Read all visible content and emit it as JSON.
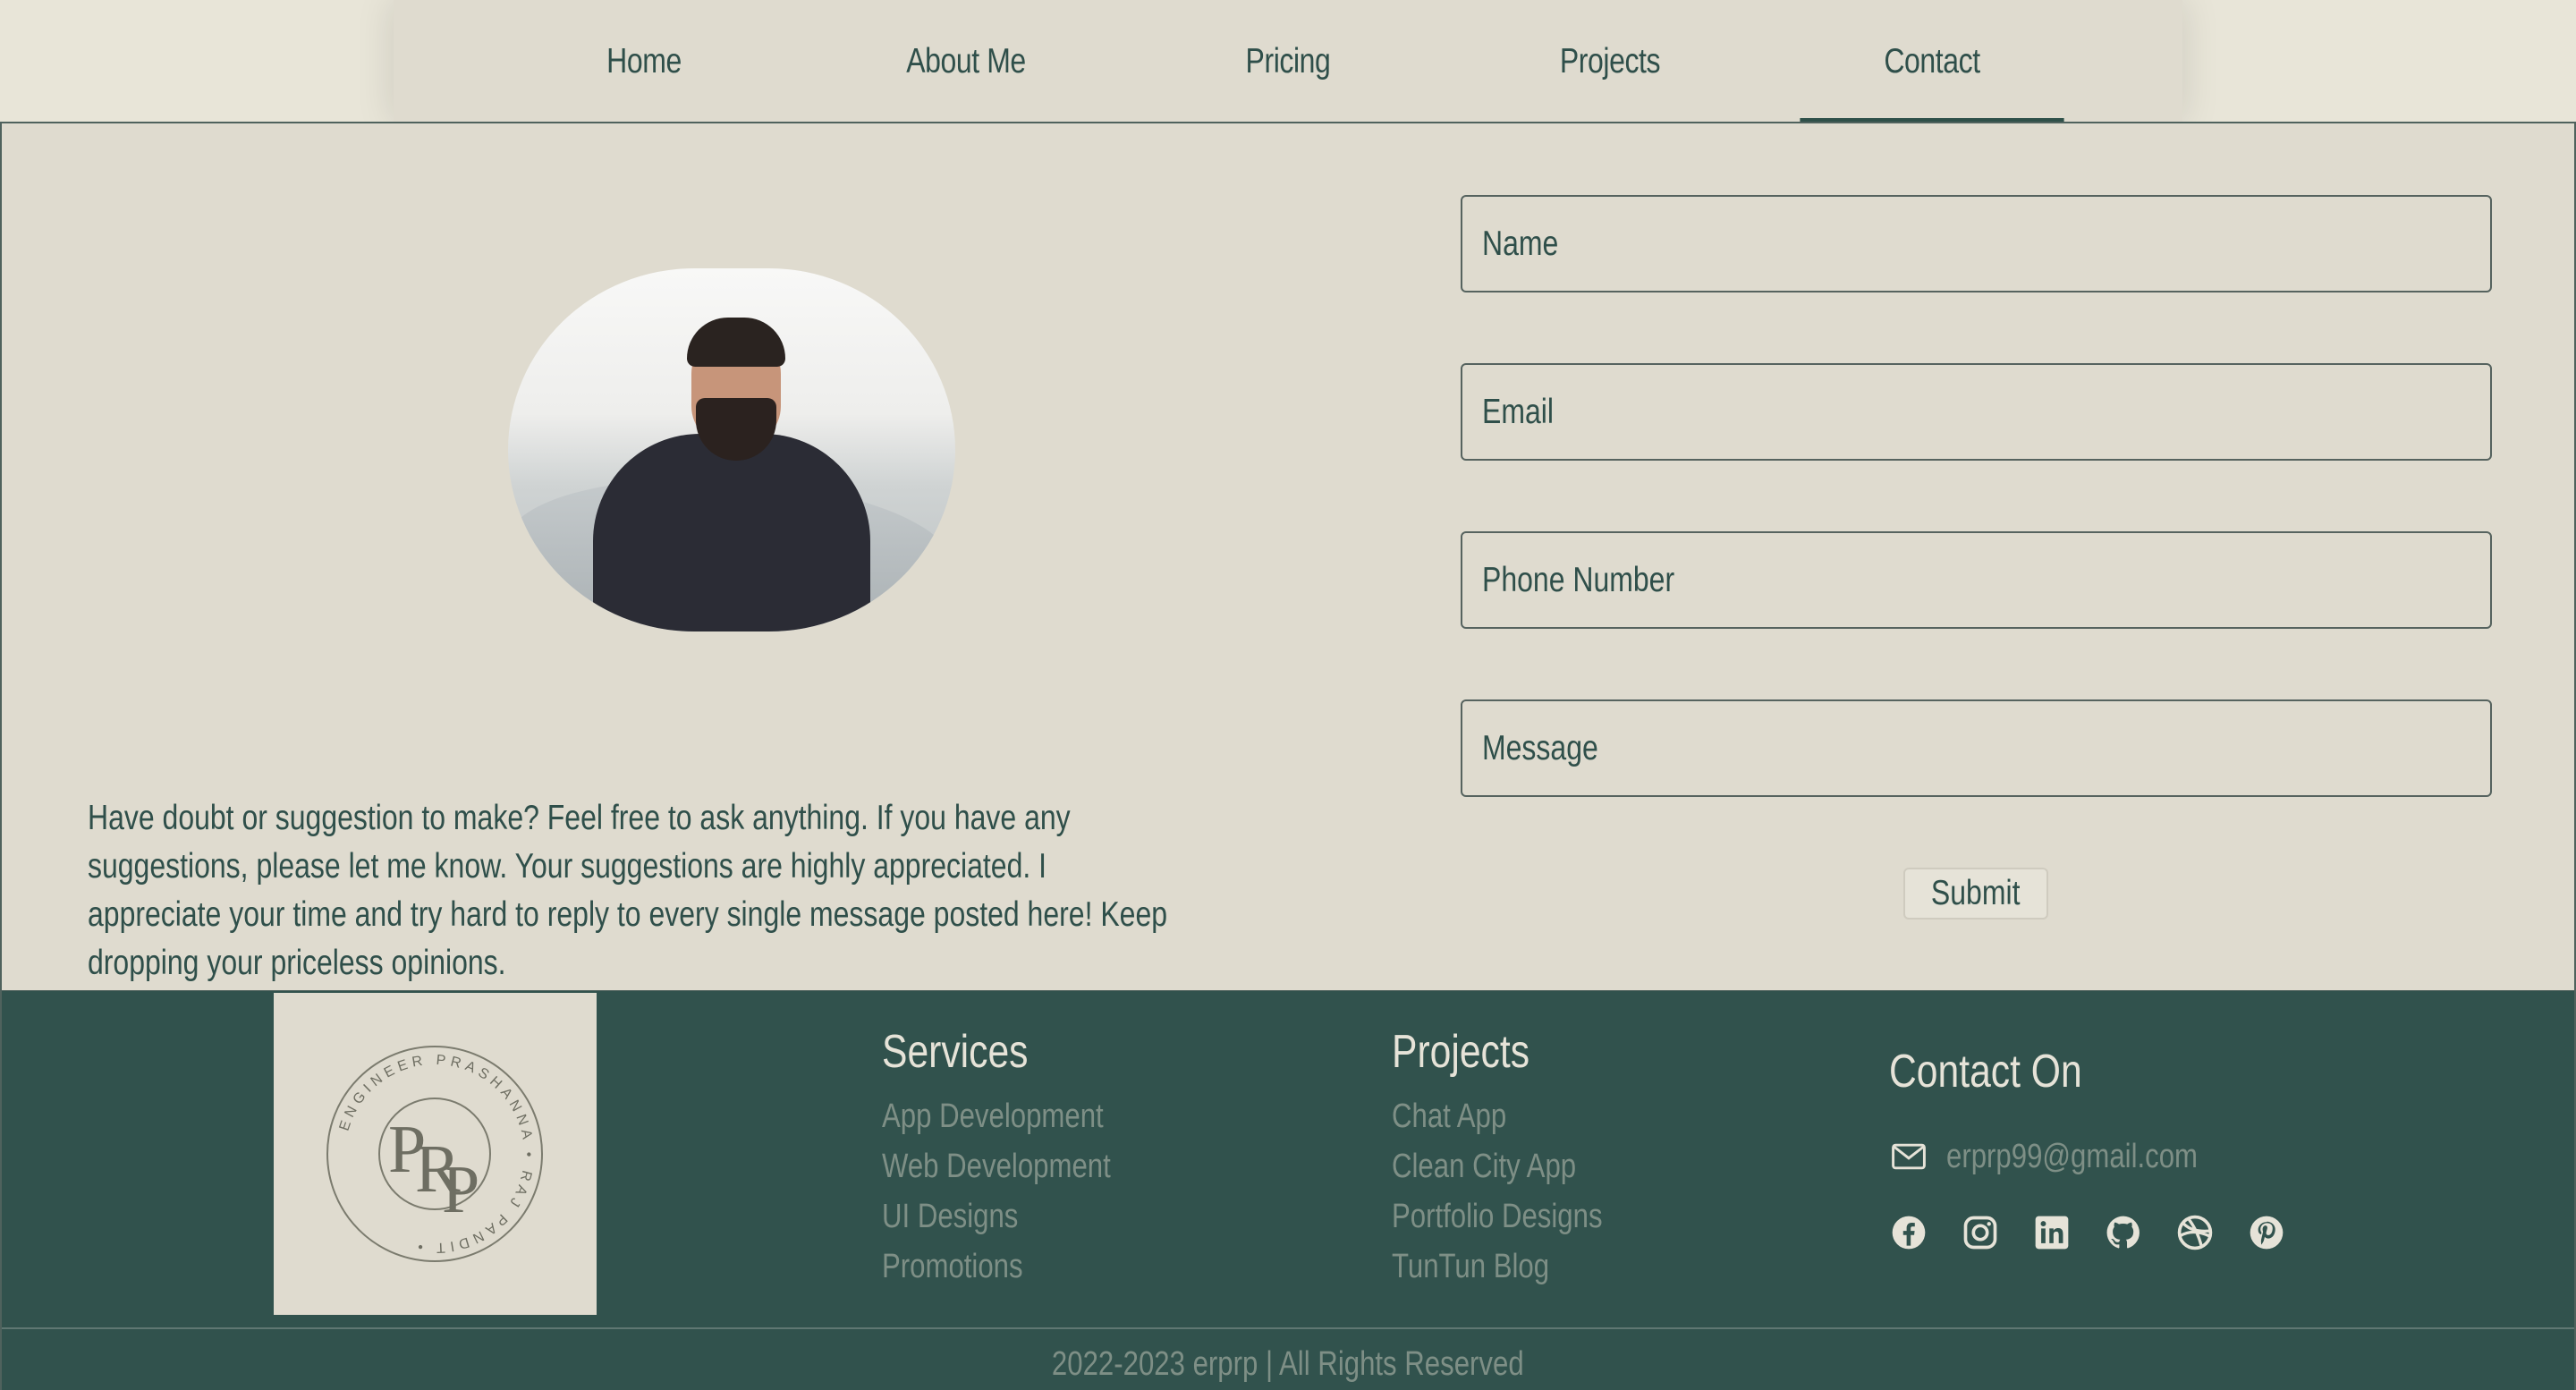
{
  "nav": {
    "items": [
      {
        "label": "Home"
      },
      {
        "label": "About Me"
      },
      {
        "label": "Pricing"
      },
      {
        "label": "Projects"
      },
      {
        "label": "Contact"
      }
    ],
    "active": "Contact"
  },
  "contact": {
    "intro": "Have doubt or suggestion to make? Feel free to ask anything. If you have any suggestions, please let me know. Your suggestions are highly appreciated. I appreciate your time and try hard to reply to every single message posted here! Keep dropping your priceless opinions.",
    "form": {
      "name_placeholder": "Name",
      "email_placeholder": "Email",
      "phone_placeholder": "Phone Number",
      "message_placeholder": "Message",
      "submit_label": "Submit"
    }
  },
  "footer": {
    "logo": {
      "initials": "PRP",
      "ring_text": "ENGINEER PRASHANNA • RAJ PANDIT •"
    },
    "services": {
      "title": "Services",
      "items": [
        "App Development",
        "Web Development",
        "UI Designs",
        "Promotions"
      ]
    },
    "projects": {
      "title": "Projects",
      "items": [
        "Chat App",
        "Clean City App",
        "Portfolio Designs",
        "TunTun Blog"
      ]
    },
    "contact": {
      "title": "Contact On",
      "email": "erprp99@gmail.com",
      "socials": [
        "facebook-icon",
        "instagram-icon",
        "linkedin-icon",
        "github-icon",
        "dribbble-icon",
        "pinterest-icon"
      ]
    },
    "copyright": "2022-2023 erprp | All Rights Reserved"
  },
  "colors": {
    "background": "#dfdbcf",
    "footer": "#31524d",
    "text": "#2f4f4a",
    "muted": "#7e8f86"
  }
}
